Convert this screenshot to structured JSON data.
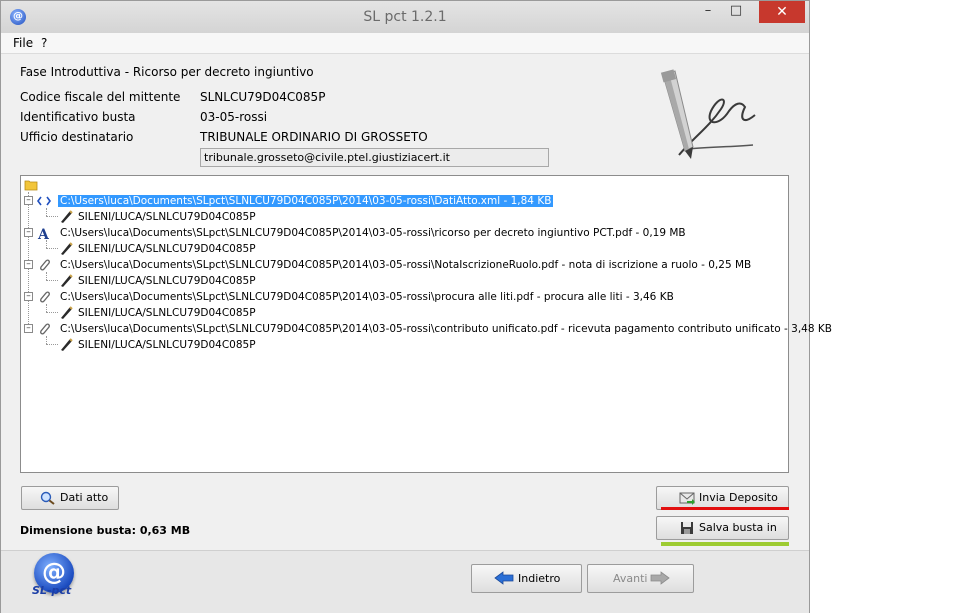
{
  "window": {
    "title": "SL pct 1.2.1",
    "minimize": "–",
    "maximize": "□",
    "close": "✕"
  },
  "menu": [
    "File",
    "?"
  ],
  "form": {
    "title": "Fase Introduttiva - Ricorso per decreto ingiuntivo",
    "fields": [
      {
        "label": "Codice fiscale del mittente",
        "value": "SLNLCU79D04C085P"
      },
      {
        "label": "Identificativo busta",
        "value": "03-05-rossi"
      },
      {
        "label": "Ufficio destinatario",
        "value": "TRIBUNALE ORDINARIO DI GROSSETO"
      }
    ],
    "pec": "tribunale.grosseto@civile.ptel.giustiziacert.it"
  },
  "tree": {
    "root_icon": "folder-icon",
    "items": [
      {
        "icon": "xml-icon",
        "path": "C:\\Users\\luca\\Documents\\SLpct\\SLNLCU79D04C085P\\2014\\03-05-rossi\\DatiAtto.xml - 1,84 KB",
        "signer": "SILENI/LUCA/SLNLCU79D04C085P",
        "selected": true
      },
      {
        "icon": "text-icon",
        "path": "C:\\Users\\luca\\Documents\\SLpct\\SLNLCU79D04C085P\\2014\\03-05-rossi\\ricorso per decreto ingiuntivo PCT.pdf - 0,19 MB",
        "signer": "SILENI/LUCA/SLNLCU79D04C085P",
        "selected": false
      },
      {
        "icon": "paperclip-icon",
        "path": "C:\\Users\\luca\\Documents\\SLpct\\SLNLCU79D04C085P\\2014\\03-05-rossi\\NotaIscrizioneRuolo.pdf - nota di iscrizione a ruolo - 0,25 MB",
        "signer": "SILENI/LUCA/SLNLCU79D04C085P",
        "selected": false
      },
      {
        "icon": "paperclip-icon",
        "path": "C:\\Users\\luca\\Documents\\SLpct\\SLNLCU79D04C085P\\2014\\03-05-rossi\\procura alle liti.pdf - procura alle liti - 3,46 KB",
        "signer": "SILENI/LUCA/SLNLCU79D04C085P",
        "selected": false
      },
      {
        "icon": "paperclip-icon",
        "path": "C:\\Users\\luca\\Documents\\SLpct\\SLNLCU79D04C085P\\2014\\03-05-rossi\\contributo unificato.pdf - ricevuta pagamento contributo unificato - 3,48 KB",
        "signer": "SILENI/LUCA/SLNLCU79D04C085P",
        "selected": false
      }
    ]
  },
  "buttons": {
    "dati_atto": "Dati atto",
    "invia_deposito": "Invia Deposito",
    "salva_busta": "Salva busta in",
    "indietro": "Indietro",
    "avanti": "Avanti"
  },
  "dimensione": "Dimensione busta: 0,63 MB",
  "logo": {
    "symbol": "@",
    "text": "SL-pct"
  },
  "colors": {
    "selection": "#3399ff",
    "close": "#c7382d",
    "red_mark": "#e20f0f",
    "green_mark": "#9dcb32"
  }
}
